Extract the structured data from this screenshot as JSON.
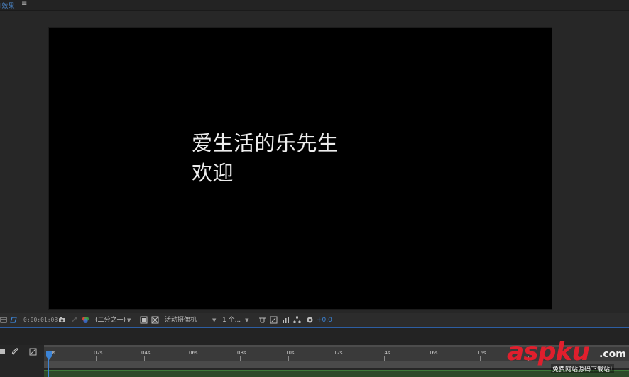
{
  "panel": {
    "tab_label": "l效果",
    "menu_glyph": "≡"
  },
  "composition": {
    "text_line1": "爱生活的乐先生",
    "text_line2": "欢迎"
  },
  "viewer_toolbar": {
    "timecode": "0:00:01:08",
    "resolution": "(二分之一)",
    "camera": "活动摄像机",
    "views": "1 个...",
    "exposure_offset": "+0.0"
  },
  "timeline": {
    "ticks": [
      "0s",
      "02s",
      "04s",
      "06s",
      "08s",
      "10s",
      "12s",
      "14s",
      "16s",
      "16s"
    ]
  },
  "watermark": {
    "brand_asp": "asp",
    "brand_ku": "ku",
    "brand_com": ".com",
    "tagline": "免费网站源码下载站!"
  },
  "colors": {
    "accent_blue": "#3c84d6",
    "watermark_red": "#e01f2d"
  }
}
